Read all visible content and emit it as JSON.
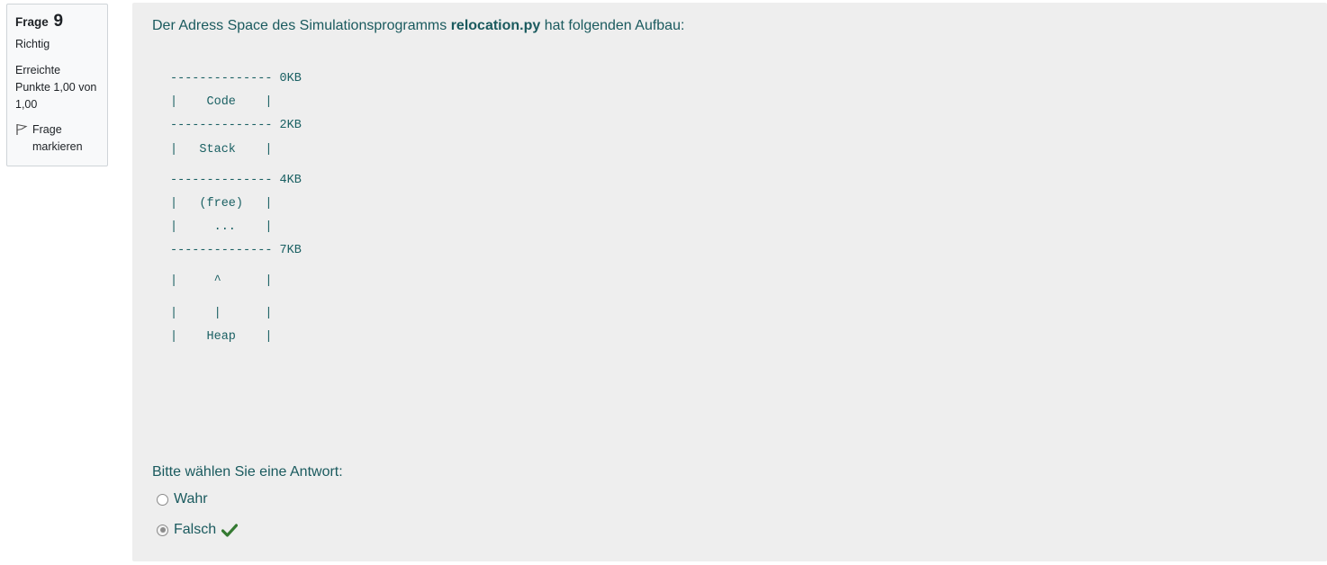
{
  "info": {
    "question_label": "Frage",
    "question_number": "9",
    "state": "Richtig",
    "grade_lines": [
      "Erreichte",
      "Punkte 1,00 von",
      "1,00"
    ],
    "flag_lines": [
      "Frage",
      "markieren"
    ]
  },
  "question": {
    "text_before": "Der Adress Space des Simulationsprogramms ",
    "text_bold": "relocation.py",
    "text_after": " hat folgenden Aufbau:",
    "diagram_lines": [
      "-------------- 0KB",
      "|    Code    |",
      "-------------- 2KB",
      "|   Stack    |",
      "-------------- 4KB",
      "|   (free)   |",
      "|     ...    |",
      "-------------- 7KB",
      "|     ^      |",
      "|     |      |",
      "|    Heap    |"
    ],
    "answer_prompt": "Bitte wählen Sie eine Antwort:",
    "options": [
      {
        "label": "Wahr",
        "checked": false
      },
      {
        "label": "Falsch",
        "checked": true,
        "correct": true
      }
    ]
  },
  "colors": {
    "text": "#1a5a5e",
    "panel_bg": "#eeeeee",
    "correct_check": "#357a32"
  },
  "icons": {
    "flag": "flag-icon",
    "correct": "check-icon"
  }
}
